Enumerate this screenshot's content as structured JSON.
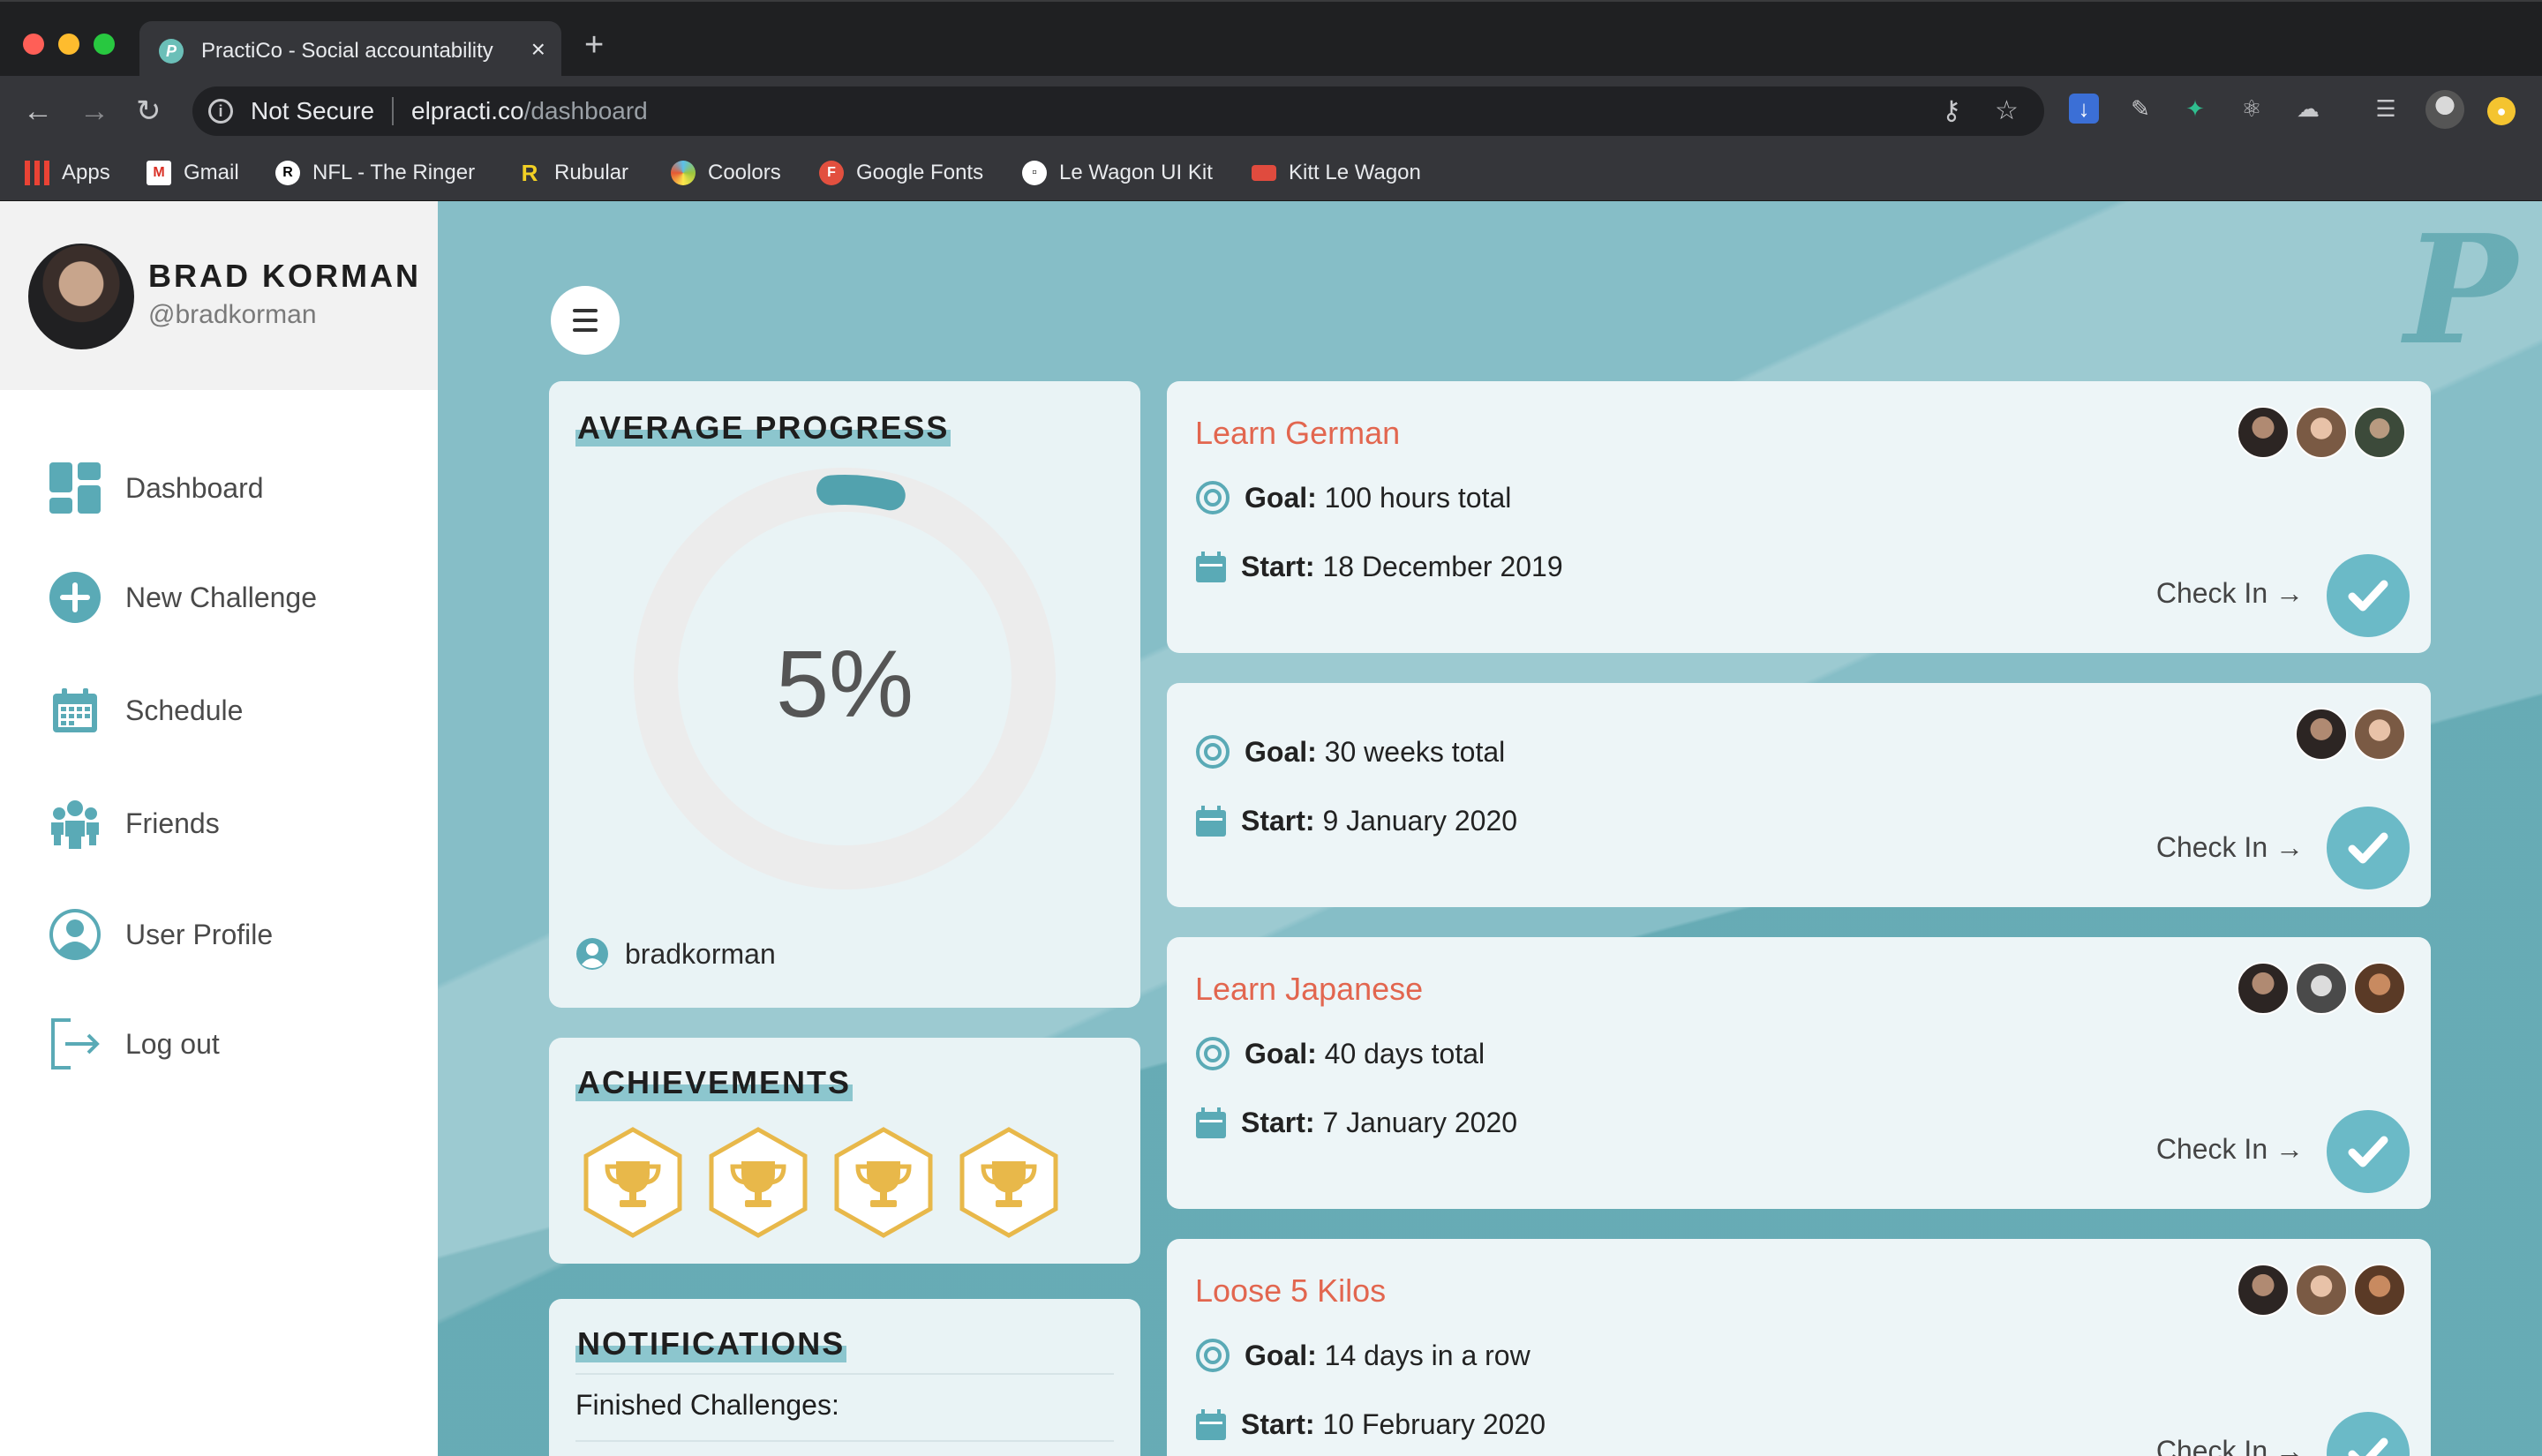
{
  "browser": {
    "tab_title": "PractiCo - Social accountability",
    "tab_close": "×",
    "new_tab": "+",
    "security_label": "Not Secure",
    "url_host": "elpracti.co",
    "url_path": "/dashboard",
    "bookmarks": [
      {
        "label": "Apps",
        "icon": "apps-grid-icon"
      },
      {
        "label": "Gmail",
        "icon": "gmail-icon"
      },
      {
        "label": "NFL - The Ringer",
        "icon": "ringer-icon"
      },
      {
        "label": "Rubular",
        "icon": "rubular-icon"
      },
      {
        "label": "Coolors",
        "icon": "coolors-icon"
      },
      {
        "label": "Google Fonts",
        "icon": "google-fonts-icon"
      },
      {
        "label": "Le Wagon UI Kit",
        "icon": "lewagon-icon"
      },
      {
        "label": "Kitt Le Wagon",
        "icon": "kitt-icon"
      }
    ]
  },
  "profile": {
    "name": "BRAD KORMAN",
    "handle": "@bradkorman"
  },
  "sidebar": {
    "items": [
      {
        "label": "Dashboard",
        "icon": "dashboard-icon"
      },
      {
        "label": "New Challenge",
        "icon": "plus-circle-icon"
      },
      {
        "label": "Schedule",
        "icon": "calendar-icon"
      },
      {
        "label": "Friends",
        "icon": "friends-icon"
      },
      {
        "label": "User Profile",
        "icon": "user-profile-icon"
      },
      {
        "label": "Log out",
        "icon": "logout-icon"
      }
    ]
  },
  "progress": {
    "title": "AVERAGE PROGRESS",
    "percent_label": "5%",
    "percent_value": 5,
    "user": "bradkorman"
  },
  "achievements": {
    "title": "ACHIEVEMENTS",
    "count": 4
  },
  "notifications": {
    "title": "NOTIFICATIONS",
    "subtitle": "Finished Challenges:"
  },
  "challenges": [
    {
      "title": "Learn German",
      "goal_label": "Goal:",
      "goal": "100 hours total",
      "start_label": "Start:",
      "start": "18 December 2019",
      "checkin": "Check In →",
      "members": 3
    },
    {
      "title": "",
      "goal_label": "Goal:",
      "goal": "30 weeks total",
      "start_label": "Start:",
      "start": "9 January 2020",
      "checkin": "Check In →",
      "members": 2
    },
    {
      "title": "Learn Japanese",
      "goal_label": "Goal:",
      "goal": "40 days total",
      "start_label": "Start:",
      "start": "7 January 2020",
      "checkin": "Check In →",
      "members": 3
    },
    {
      "title": "Loose 5 Kilos",
      "goal_label": "Goal:",
      "goal": "14 days in a row",
      "start_label": "Start:",
      "start": "10 February 2020",
      "checkin": "Check In →",
      "members": 3
    }
  ],
  "colors": {
    "accent": "#5aaab6",
    "challenge_title": "#e2664f",
    "background": "#86bec7",
    "trophy": "#e8b84a"
  }
}
